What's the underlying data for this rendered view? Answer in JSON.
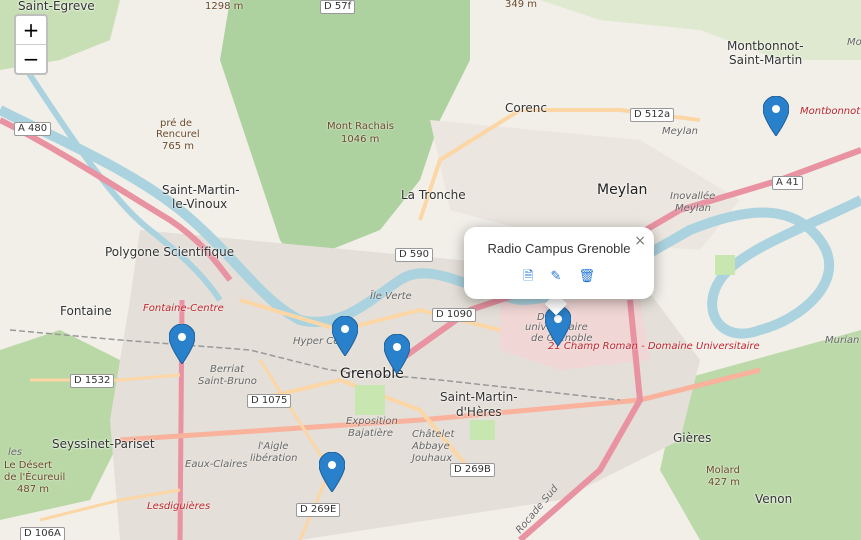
{
  "zoom": {
    "in_label": "+",
    "out_label": "−"
  },
  "popup": {
    "title": "Radio Campus Grenoble",
    "close_label": "×",
    "actions": [
      {
        "icon": "file-icon",
        "glyph": "🗎"
      },
      {
        "icon": "edit-icon",
        "glyph": "✎"
      },
      {
        "icon": "trash-icon",
        "glyph": "🗑"
      }
    ]
  },
  "places": {
    "saint_egreve": "Saint-Egreve",
    "montbonnot": "Montbonnot-",
    "montbonnot2": "Saint-Martin",
    "corenc": "Corenc",
    "meylan": "Meylan",
    "meylan_it": "Meylan",
    "la_tronche": "La Tronche",
    "saint_martin_le_vinoux": "Saint-Martin-",
    "saint_martin_le_vinoux2": "le-Vinoux",
    "polygone": "Polygone Scientifique",
    "fontaine": "Fontaine",
    "grenoble": "Grenoble",
    "smh1": "Saint-Martin-",
    "smh2": "d'Hères",
    "seyssinet": "Seyssinet-Pariset",
    "gieres": "Gières",
    "venon": "Venon",
    "murianette": "Murian",
    "ile_verte": "Île Verte",
    "hyper_centre": "Hyper Cen",
    "berriat": "Berriat",
    "saint_bruno": "Saint-Bruno",
    "eaux_claires": "Eaux-Claires",
    "exposition": "Exposition",
    "bajatiere": "Bajatière",
    "chatelet": "Châtelet",
    "abbaye": "Abbaye",
    "jouhaux": "Jouhaux",
    "alliance": "l'Aigle",
    "liberation": "libération",
    "inovallee": "Inovallée",
    "inovallee2": "Meylan",
    "domaine": "Dom",
    "universitaire": "universitaire",
    "de_grenoble": "de Grenoble"
  },
  "red_labels": {
    "fontaine_centre": "Fontaine-Centre",
    "champ_roman": "21 Champ Roman - Domaine Universitaire",
    "montbonnot": "Montbonnot -",
    "lesdiguieres": "Lesdiguières"
  },
  "roads": {
    "a480": "A 480",
    "d590": "D 590",
    "d1090": "D 1090",
    "d1075": "D 1075",
    "d1532": "D 1532",
    "d269b": "D 269B",
    "d269e": "D 269E",
    "d106a": "D 106A",
    "d512a": "D 512a",
    "a41": "A 41",
    "d57f": "D 57f",
    "rn87": "Rocade Sud"
  },
  "peaks": {
    "rencurel_1": "pré de",
    "rencurel_2": "Rencurel",
    "rencurel_3": "765 m",
    "rachais_1": "Mont Rachais",
    "rachais_2": "1046 m",
    "molard_1": "Molard",
    "molard_2": "427 m",
    "ecureuil_1": "Le Désert",
    "ecureuil_2": "de l'Écureuil",
    "ecureuil_3": "487 m",
    "top1": "1298 m",
    "top2": "349 m",
    "les": "les",
    "mo": "Mo"
  },
  "markers": [
    {
      "name": "marker-meylan"
    },
    {
      "name": "marker-fontaine"
    },
    {
      "name": "marker-hyper-centre"
    },
    {
      "name": "marker-grenoble-east"
    },
    {
      "name": "marker-radio-campus"
    },
    {
      "name": "marker-south"
    }
  ]
}
